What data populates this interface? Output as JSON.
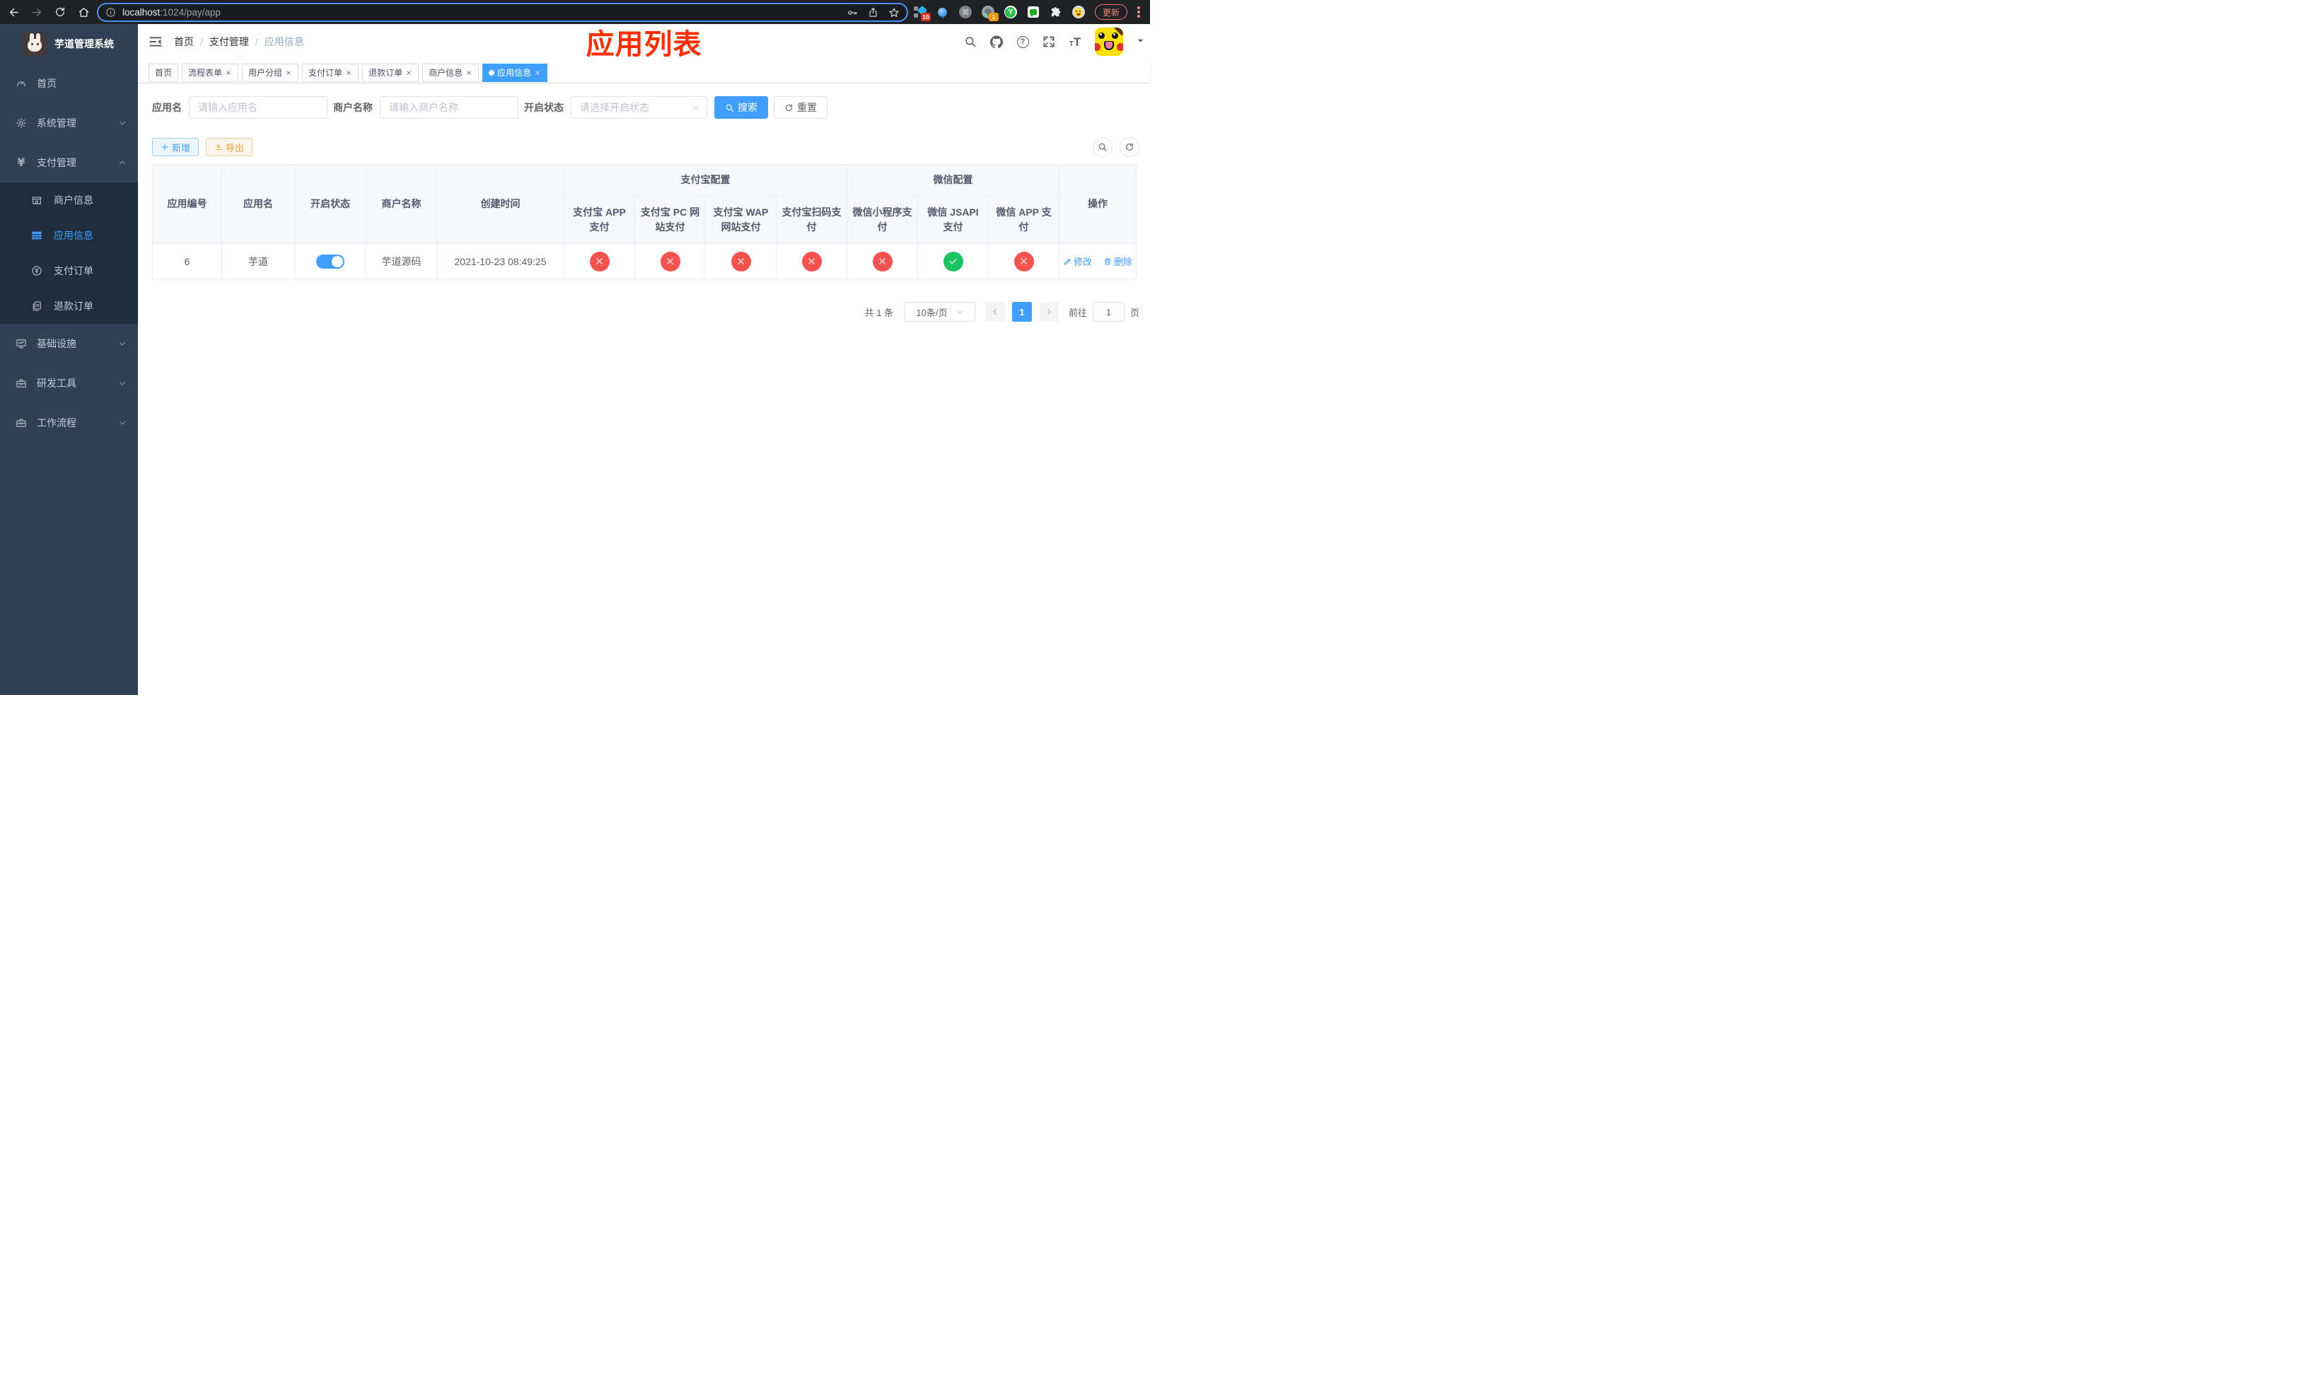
{
  "colors": {
    "accent": "#409eff",
    "success": "#1ec263",
    "danger": "#f7534e",
    "annotation_red": "#ff2f00",
    "sidebar_bg": "#304156",
    "submenu_bg": "#1f2d3d"
  },
  "browser": {
    "url_host": "localhost",
    "url_path": ":1024/pay/app",
    "update_label": "更新",
    "ext_badge_diamond": "10",
    "ext_badge_profile": "1"
  },
  "sidebar": {
    "logo_title": "芋道管理系统",
    "menu": [
      {
        "label": "首页"
      },
      {
        "label": "系统管理"
      },
      {
        "label": "支付管理"
      },
      {
        "label": "基础设施"
      },
      {
        "label": "研发工具"
      },
      {
        "label": "工作流程"
      }
    ],
    "pay_submenu": [
      {
        "label": "商户信息",
        "active": false
      },
      {
        "label": "应用信息",
        "active": true
      },
      {
        "label": "支付订单",
        "active": false
      },
      {
        "label": "退款订单",
        "active": false
      }
    ]
  },
  "header": {
    "breadcrumb": [
      "首页",
      "支付管理",
      "应用信息"
    ],
    "separator": "/",
    "annotation": "应用列表"
  },
  "tabs": [
    {
      "label": "首页",
      "closable": false,
      "active": false
    },
    {
      "label": "流程表单",
      "closable": true,
      "active": false
    },
    {
      "label": "用户分组",
      "closable": true,
      "active": false
    },
    {
      "label": "支付订单",
      "closable": true,
      "active": false
    },
    {
      "label": "退款订单",
      "closable": true,
      "active": false
    },
    {
      "label": "商户信息",
      "closable": true,
      "active": false
    },
    {
      "label": "应用信息",
      "closable": true,
      "active": true
    }
  ],
  "filters": {
    "app_name_label": "应用名",
    "app_name_placeholder": "请输入应用名",
    "merchant_label": "商户名称",
    "merchant_placeholder": "请输入商户名称",
    "status_label": "开启状态",
    "status_placeholder": "请选择开启状态",
    "search_button": "搜索",
    "reset_button": "重置"
  },
  "toolbar": {
    "add_button": "新增",
    "export_button": "导出"
  },
  "table": {
    "columns": [
      "应用编号",
      "应用名",
      "开启状态",
      "商户名称",
      "创建时间"
    ],
    "alipay_group": "支付宝配置",
    "alipay_cols": [
      "支付宝 APP 支付",
      "支付宝 PC 网站支付",
      "支付宝 WAP 网站支付",
      "支付宝扫码支付"
    ],
    "wechat_group": "微信配置",
    "wechat_cols": [
      "微信小程序支付",
      "微信 JSAPI 支付",
      "微信 APP 支付"
    ],
    "actions_col": "操作",
    "row": {
      "id": "6",
      "name": "芋道",
      "enabled": true,
      "merchant": "芋道源码",
      "created": "2021-10-23 08:49:25",
      "statuses": {
        "alipay_app": false,
        "alipay_pc": false,
        "alipay_wap": false,
        "alipay_qr": false,
        "wechat_mini": false,
        "wechat_jsapi": true,
        "wechat_app": false
      },
      "edit_label": "修改",
      "delete_label": "删除"
    }
  },
  "pagination": {
    "total_text": "共 1 条",
    "page_size": "10条/页",
    "current_page": "1",
    "goto_label": "前往",
    "goto_value": "1",
    "goto_unit": "页"
  }
}
